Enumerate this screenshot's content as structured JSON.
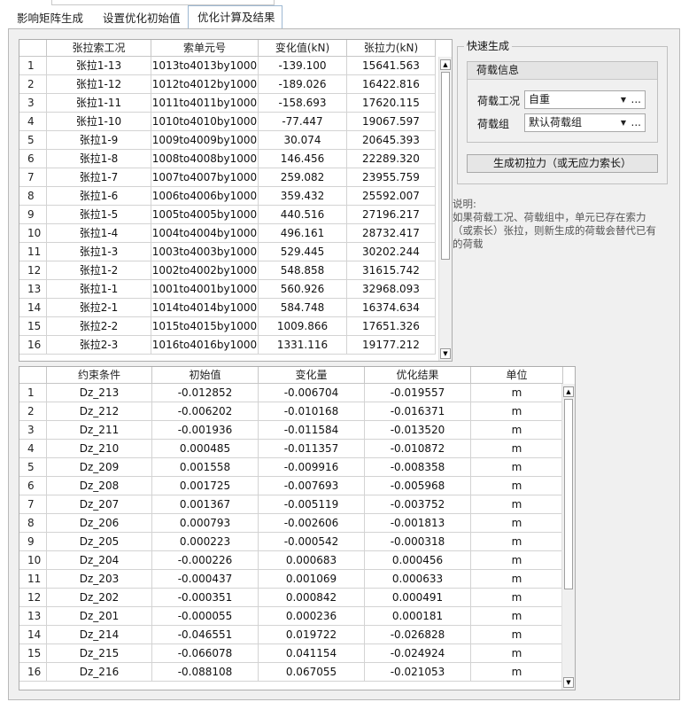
{
  "tabs": [
    {
      "label": "影响矩阵生成"
    },
    {
      "label": "设置优化初始值"
    },
    {
      "label": "优化计算及结果"
    }
  ],
  "cable_table": {
    "headers": [
      "",
      "张拉索工况",
      "索单元号",
      "变化值(kN)",
      "张拉力(kN)"
    ],
    "rows": [
      [
        "1",
        "张拉1-13",
        "1013to4013by1000",
        "-139.100",
        "15641.563"
      ],
      [
        "2",
        "张拉1-12",
        "1012to4012by1000",
        "-189.026",
        "16422.816"
      ],
      [
        "3",
        "张拉1-11",
        "1011to4011by1000",
        "-158.693",
        "17620.115"
      ],
      [
        "4",
        "张拉1-10",
        "1010to4010by1000",
        "-77.447",
        "19067.597"
      ],
      [
        "5",
        "张拉1-9",
        "1009to4009by1000",
        "30.074",
        "20645.393"
      ],
      [
        "6",
        "张拉1-8",
        "1008to4008by1000",
        "146.456",
        "22289.320"
      ],
      [
        "7",
        "张拉1-7",
        "1007to4007by1000",
        "259.082",
        "23955.759"
      ],
      [
        "8",
        "张拉1-6",
        "1006to4006by1000",
        "359.432",
        "25592.007"
      ],
      [
        "9",
        "张拉1-5",
        "1005to4005by1000",
        "440.516",
        "27196.217"
      ],
      [
        "10",
        "张拉1-4",
        "1004to4004by1000",
        "496.161",
        "28732.417"
      ],
      [
        "11",
        "张拉1-3",
        "1003to4003by1000",
        "529.445",
        "30202.244"
      ],
      [
        "12",
        "张拉1-2",
        "1002to4002by1000",
        "548.858",
        "31615.742"
      ],
      [
        "13",
        "张拉1-1",
        "1001to4001by1000",
        "560.926",
        "32968.093"
      ],
      [
        "14",
        "张拉2-1",
        "1014to4014by1000",
        "584.748",
        "16374.634"
      ],
      [
        "15",
        "张拉2-2",
        "1015to4015by1000",
        "1009.866",
        "17651.326"
      ],
      [
        "16",
        "张拉2-3",
        "1016to4016by1000",
        "1331.116",
        "19177.212"
      ]
    ]
  },
  "constraint_table": {
    "headers": [
      "",
      "约束条件",
      "初始值",
      "变化量",
      "优化结果",
      "单位"
    ],
    "rows": [
      [
        "1",
        "Dz_213",
        "-0.012852",
        "-0.006704",
        "-0.019557",
        "m"
      ],
      [
        "2",
        "Dz_212",
        "-0.006202",
        "-0.010168",
        "-0.016371",
        "m"
      ],
      [
        "3",
        "Dz_211",
        "-0.001936",
        "-0.011584",
        "-0.013520",
        "m"
      ],
      [
        "4",
        "Dz_210",
        "0.000485",
        "-0.011357",
        "-0.010872",
        "m"
      ],
      [
        "5",
        "Dz_209",
        "0.001558",
        "-0.009916",
        "-0.008358",
        "m"
      ],
      [
        "6",
        "Dz_208",
        "0.001725",
        "-0.007693",
        "-0.005968",
        "m"
      ],
      [
        "7",
        "Dz_207",
        "0.001367",
        "-0.005119",
        "-0.003752",
        "m"
      ],
      [
        "8",
        "Dz_206",
        "0.000793",
        "-0.002606",
        "-0.001813",
        "m"
      ],
      [
        "9",
        "Dz_205",
        "0.000223",
        "-0.000542",
        "-0.000318",
        "m"
      ],
      [
        "10",
        "Dz_204",
        "-0.000226",
        "0.000683",
        "0.000456",
        "m"
      ],
      [
        "11",
        "Dz_203",
        "-0.000437",
        "0.001069",
        "0.000633",
        "m"
      ],
      [
        "12",
        "Dz_202",
        "-0.000351",
        "0.000842",
        "0.000491",
        "m"
      ],
      [
        "13",
        "Dz_201",
        "-0.000055",
        "0.000236",
        "0.000181",
        "m"
      ],
      [
        "14",
        "Dz_214",
        "-0.046551",
        "0.019722",
        "-0.026828",
        "m"
      ],
      [
        "15",
        "Dz_215",
        "-0.066078",
        "0.041154",
        "-0.024924",
        "m"
      ],
      [
        "16",
        "Dz_216",
        "-0.088108",
        "0.067055",
        "-0.021053",
        "m"
      ]
    ]
  },
  "quick_gen": {
    "title": "快速生成",
    "load_info_title": "荷载信息",
    "load_case_label": "荷载工况",
    "load_case_value": "自重",
    "load_group_label": "荷载组",
    "load_group_value": "默认荷载组",
    "dots": "...",
    "generate_button": "生成初拉力（或无应力索长）"
  },
  "note": {
    "title": "说明:",
    "text": "如果荷载工况、荷载组中，单元已存在索力（或索长）张拉，则新生成的荷载会替代已有的荷载"
  },
  "icons": {
    "scroll_up": "triangle-up",
    "scroll_down": "triangle-down",
    "dropdown": "triangle-down"
  }
}
